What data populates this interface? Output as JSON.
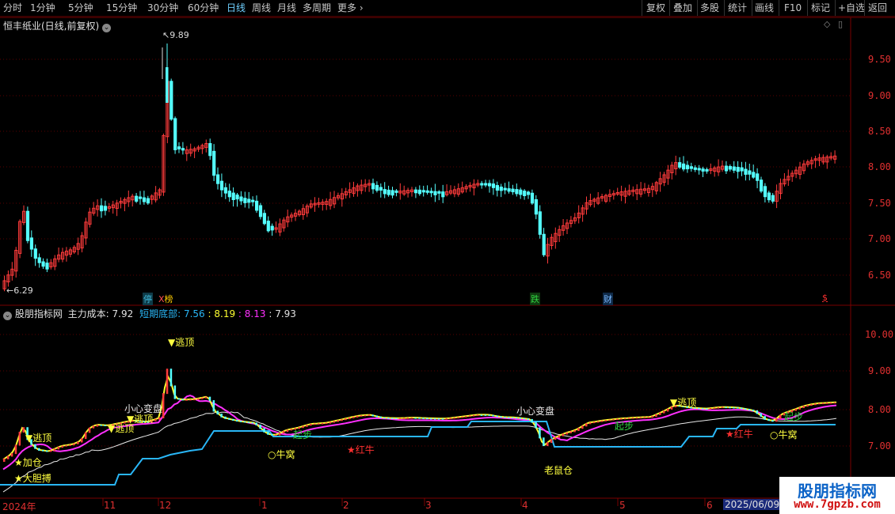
{
  "toolbar": {
    "periods": [
      "分时",
      "1分钟",
      "5分钟",
      "15分钟",
      "30分钟",
      "60分钟",
      "日线",
      "周线",
      "月线",
      "多周期",
      "更多"
    ],
    "active_period": "日线",
    "right_buttons": [
      "复权",
      "叠加",
      "多股",
      "统计",
      "画线",
      "F10",
      "标记",
      "+自选",
      "返回"
    ]
  },
  "main_panel": {
    "title": "恒丰纸业(日线,前复权)",
    "high_marker": "9.89",
    "low_marker": "6.29",
    "price_axis": [
      "9.50",
      "9.00",
      "8.50",
      "8.00",
      "7.50",
      "7.00",
      "6.50"
    ],
    "event_badges": [
      {
        "text": "停",
        "color": "#3fb7d8"
      },
      {
        "text": "榜",
        "color": "#ffcc00"
      },
      {
        "text": "跌",
        "color": "#30d040"
      },
      {
        "text": "财",
        "color": "#7ab8ff"
      },
      {
        "text": "$",
        "color": "#ff3030"
      }
    ]
  },
  "indicator_panel": {
    "name": "股朋指标网",
    "main_cost_label": "主力成本:",
    "main_cost_value": "7.92",
    "short_bottom_label": "短期底部:",
    "short_bottom_value": "7.56",
    "v3": "8.19",
    "v4": "8.13",
    "v5": "7.93",
    "axis": [
      "10.00",
      "9.00",
      "8.00",
      "7.00"
    ],
    "signals": {
      "escape_top": "逃顶",
      "careful_change": "小心变盘",
      "bull_nest": "牛窝",
      "red_bull": "红牛",
      "add_position": "加仓",
      "bold": "大胆搏",
      "rat_position": "老鼠仓",
      "start_up": "起步"
    }
  },
  "date_axis": [
    "2024年",
    "11",
    "12",
    "1",
    "2",
    "3",
    "4",
    "5",
    "6"
  ],
  "cursor_date": "2025/06/09/-",
  "watermark": {
    "main": "股朋指标网",
    "url": "www.7gpzb.com"
  },
  "colors": {
    "up": "#ff3b3b",
    "down": "#54ffff",
    "magenta": "#ff30ff",
    "yellow": "#ffff30",
    "white": "#e8e8e8",
    "cyan_line": "#29b6f6",
    "grid": "#7a0000"
  }
}
